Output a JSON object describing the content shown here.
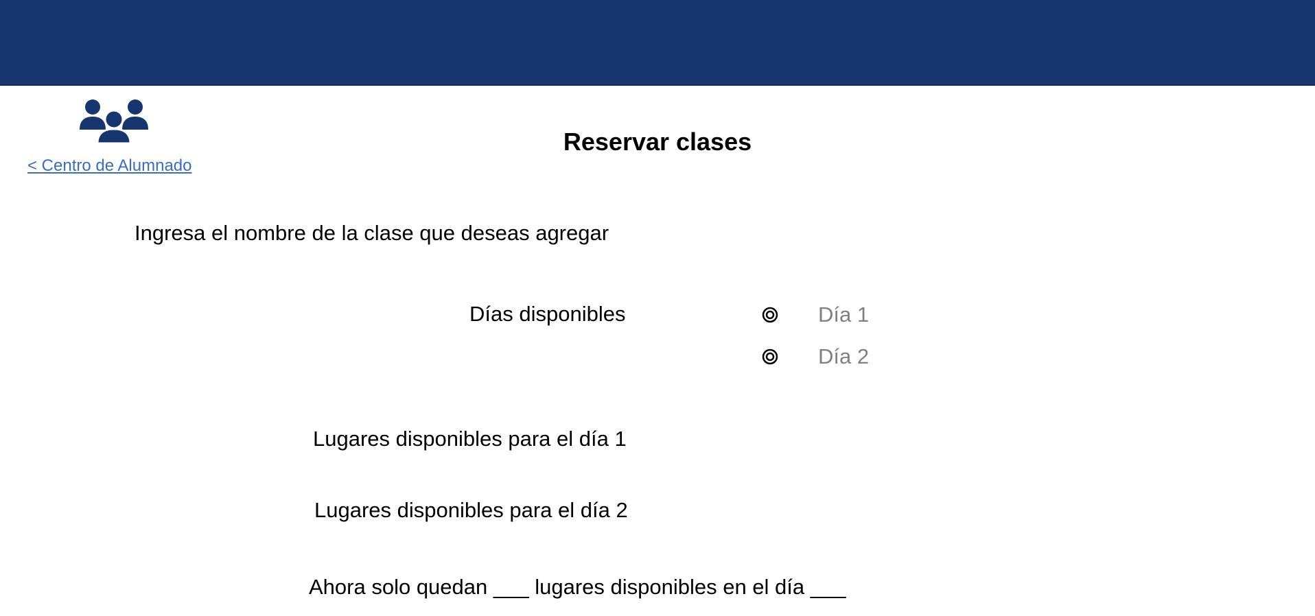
{
  "header": {
    "back_link": "< Centro de Alumnado",
    "logo_icon": "people-group-icon",
    "banner_color": "#17366f"
  },
  "main": {
    "title": "Reservar clases",
    "class_prompt": "Ingresa el nombre de la clase que deseas agregar",
    "days_label": "Días disponibles",
    "day_options": [
      {
        "label": "Día 1",
        "selected": false
      },
      {
        "label": "Día 2",
        "selected": false
      }
    ],
    "seats_day1_label": "Lugares disponibles para el día 1",
    "seats_day2_label": "Lugares disponibles para el día 2",
    "summary": "Ahora solo quedan ___ lugares disponibles en el día ___"
  }
}
